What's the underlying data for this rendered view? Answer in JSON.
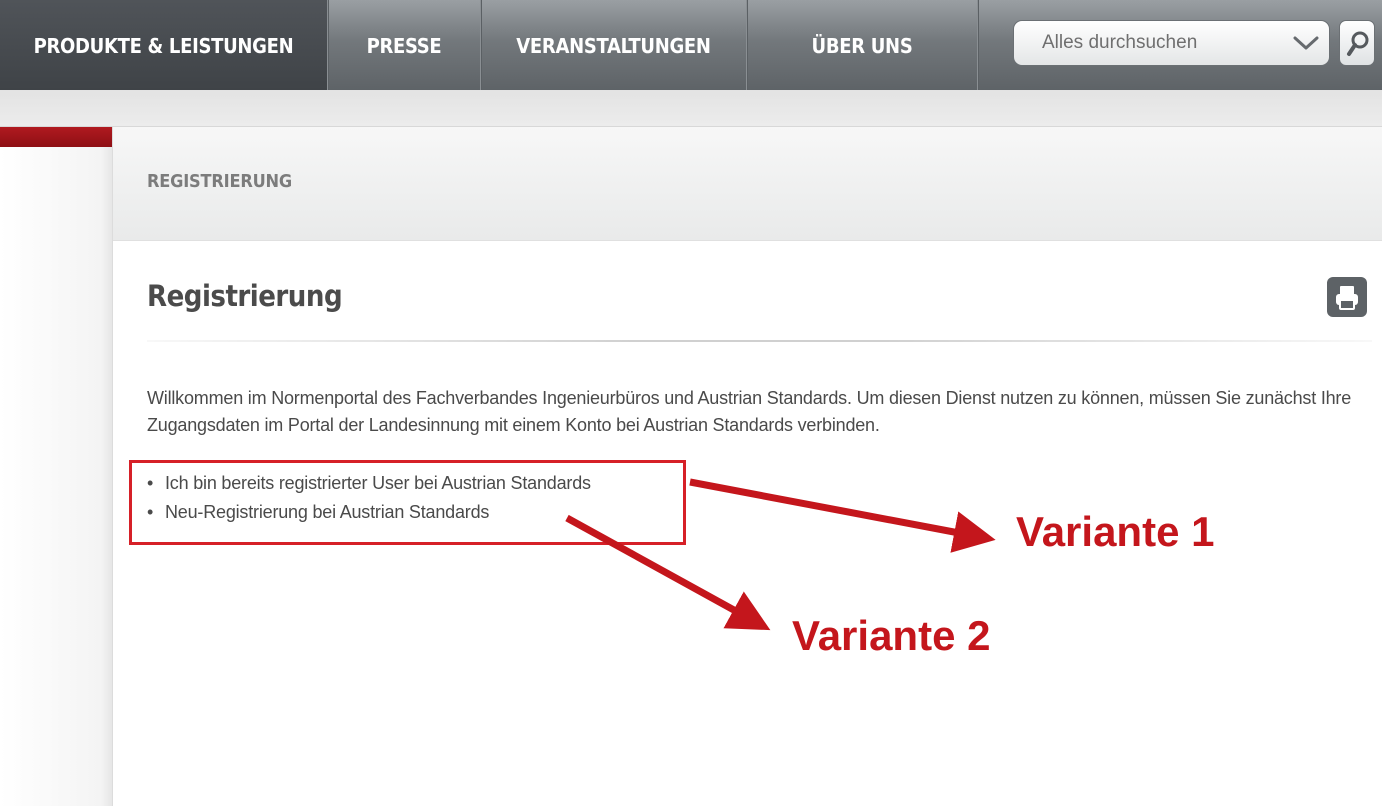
{
  "nav": {
    "items": [
      {
        "label": "PRODUKTE & LEISTUNGEN",
        "active": true
      },
      {
        "label": "PRESSE",
        "active": false
      },
      {
        "label": "VERANSTALTUNGEN",
        "active": false
      },
      {
        "label": "ÜBER UNS",
        "active": false
      }
    ],
    "search": {
      "value": "Alles durchsuchen"
    }
  },
  "breadcrumb": "REGISTRIERUNG",
  "page": {
    "title": "Registrierung",
    "intro": "Willkommen im Normenportal des Fachverbandes Ingenieurbüros und Austrian Standards. Um diesen Dienst nutzen zu können, müssen Sie zunächst Ihre Zugangsdaten im Portal der Landesinnung mit einem Konto bei Austrian Standards verbinden.",
    "options": [
      "Ich bin bereits registrierter User bei Austrian Standards",
      "Neu-Registrierung bei Austrian Standards"
    ]
  },
  "annotations": {
    "variant1": "Variante 1",
    "variant2": "Variante 2"
  },
  "colors": {
    "accent_red": "#c4161c",
    "nav_dark": "#3f4347"
  },
  "icons": [
    "chevron-down-icon",
    "search-icon",
    "print-icon"
  ]
}
